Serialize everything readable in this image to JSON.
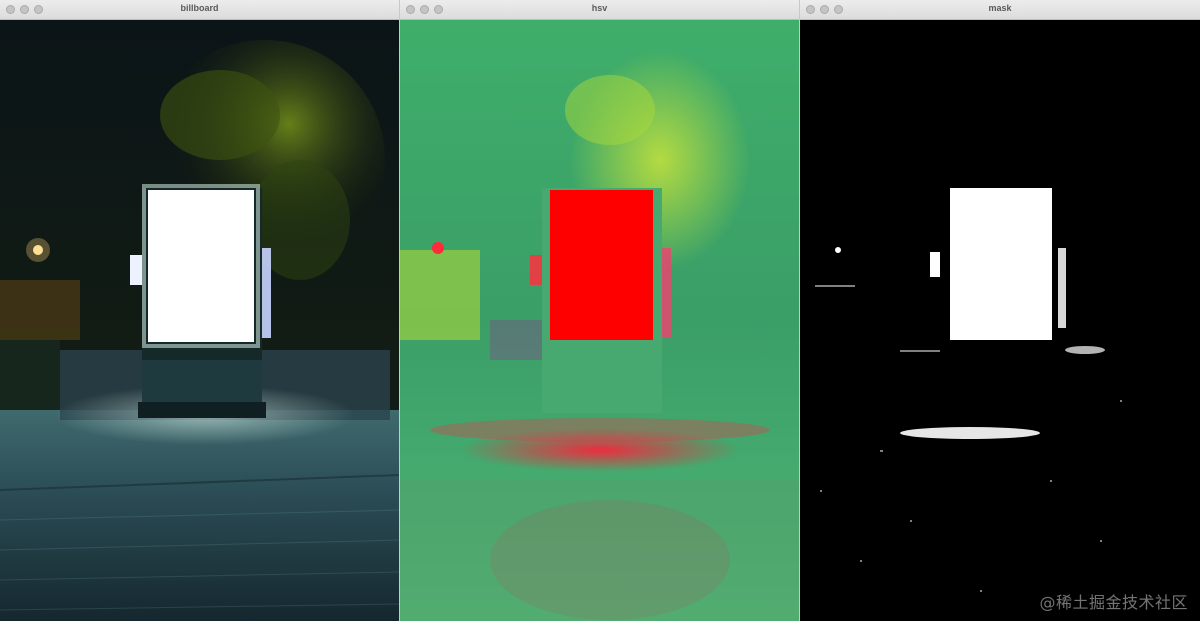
{
  "windows": [
    {
      "title": "billboard",
      "kind": "photo"
    },
    {
      "title": "hsv",
      "kind": "hsv"
    },
    {
      "title": "mask",
      "kind": "mask"
    }
  ],
  "watermark": "@稀土掘金技术社区"
}
